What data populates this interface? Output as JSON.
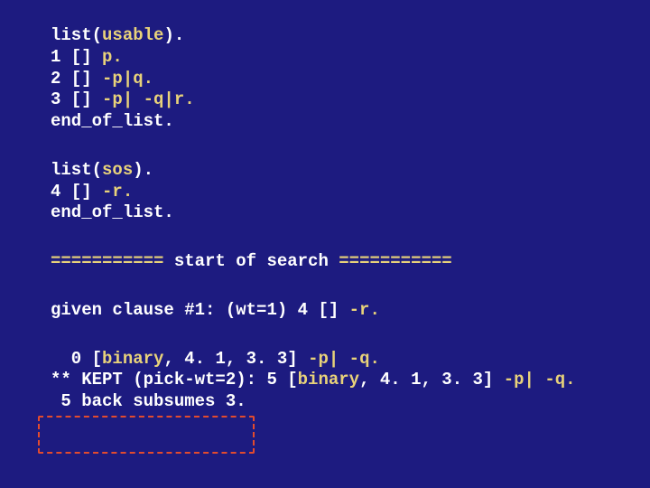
{
  "usable": {
    "open_white_1": "list(",
    "open_acc": "usable",
    "open_white_2": ").",
    "l1_a": "1 [] ",
    "l1_b": "p.",
    "l2_a": "2 [] ",
    "l2_b": "-p|q.",
    "l3_a": "3 [] ",
    "l3_b": "-p| -q|r.",
    "end": "end_of_list."
  },
  "sos": {
    "open_white_1": "list(",
    "open_acc": "sos",
    "open_white_2": ").",
    "l4_a": "4 [] ",
    "l4_b": "-r.",
    "end": "end_of_list."
  },
  "search": {
    "eq_l": "=========== ",
    "label": "start of search",
    "eq_r": " ==========="
  },
  "given": {
    "pre": "given clause #1: (wt=1) 4 [] ",
    "term": "-r."
  },
  "deriv": {
    "d0_a": "  0 [",
    "d0_b": "binary",
    "d0_c": ", 4. 1, 3. 3] ",
    "d0_d": "-p| -q.",
    "kept_a": "** KEPT (pick-wt=2): 5 [",
    "kept_b": "binary",
    "kept_c": ", 4. 1, 3. 3] ",
    "kept_d": "-p| -q.",
    "subs": " 5 back subsumes 3."
  }
}
